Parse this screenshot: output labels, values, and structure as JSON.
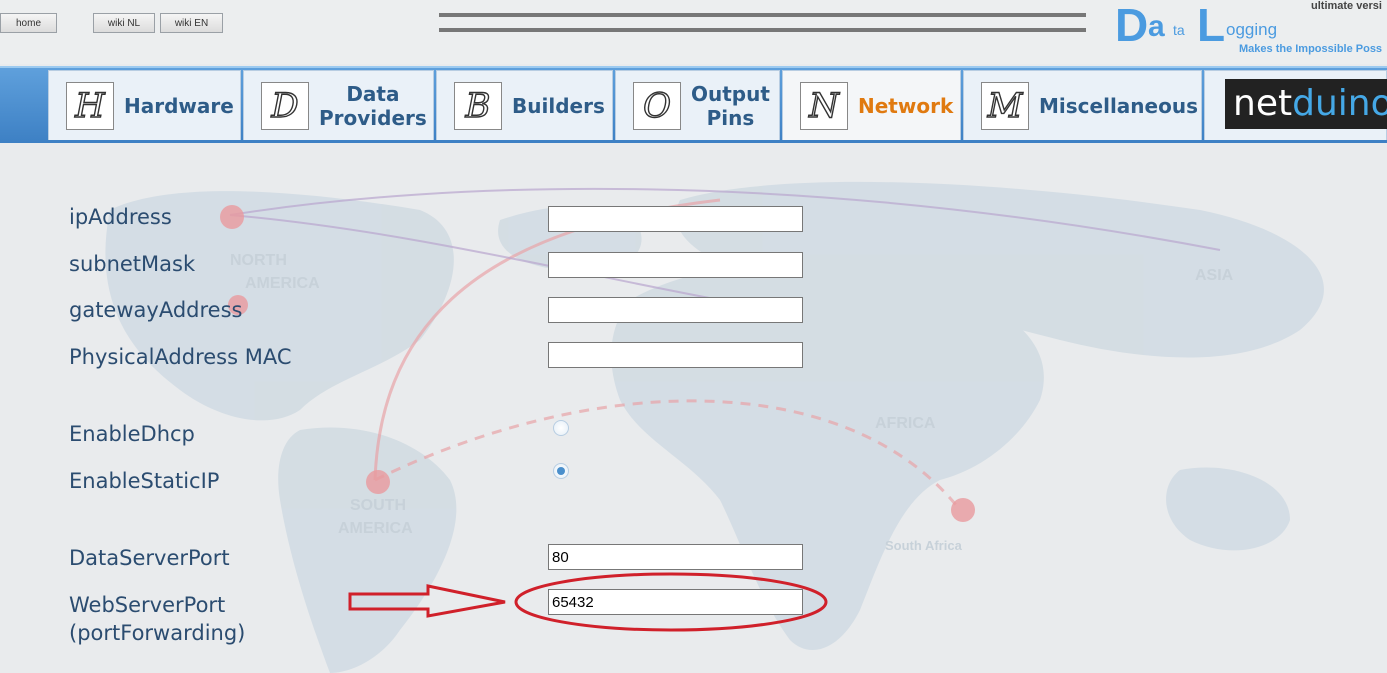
{
  "topbar": {
    "home_label": "home",
    "wiki_nl_label": "wiki NL",
    "wiki_en_label": "wiki EN"
  },
  "logo": {
    "d": "D",
    "a": "a",
    "ta": "ta",
    "l": "L",
    "ogging": "ogging",
    "version_text": "ultimate versi",
    "tagline": "Makes the Impossible Poss"
  },
  "tabs": [
    {
      "icon_letter": "H",
      "label": "Hardware"
    },
    {
      "icon_letter": "D",
      "label": "Data\nProviders"
    },
    {
      "icon_letter": "B",
      "label": "Builders"
    },
    {
      "icon_letter": "O",
      "label": "Output\nPins"
    },
    {
      "icon_letter": "N",
      "label": "Network"
    },
    {
      "icon_letter": "M",
      "label": "Miscellaneous"
    }
  ],
  "partner_logo": {
    "net": "net",
    "duino": "duino"
  },
  "form": {
    "ip_label": "ipAddress",
    "ip_value": "",
    "subnet_label": "subnetMask",
    "subnet_value": "",
    "gateway_label": "gatewayAddress",
    "gateway_value": "",
    "mac_label": "PhysicalAddress MAC",
    "mac_value": "",
    "dhcp_label": "EnableDhcp",
    "dhcp_checked": false,
    "static_label": "EnableStaticIP",
    "static_checked": true,
    "dataserver_label": "DataServerPort",
    "dataserver_value": "80",
    "webserver_label_line1": "WebServerPort",
    "webserver_label_line2": "(portForwarding)",
    "webserver_value": "65432"
  },
  "map_labels": {
    "north": "NORTH",
    "america": "AMERICA",
    "asia": "ASIA",
    "africa": "AFRICA",
    "south": "SOUTH",
    "south_america": "AMERICA",
    "south_africa": "South Africa"
  },
  "colors": {
    "accent_blue": "#4b9be0",
    "active_tab": "#e07a10",
    "annotation_red": "#d0202a"
  }
}
